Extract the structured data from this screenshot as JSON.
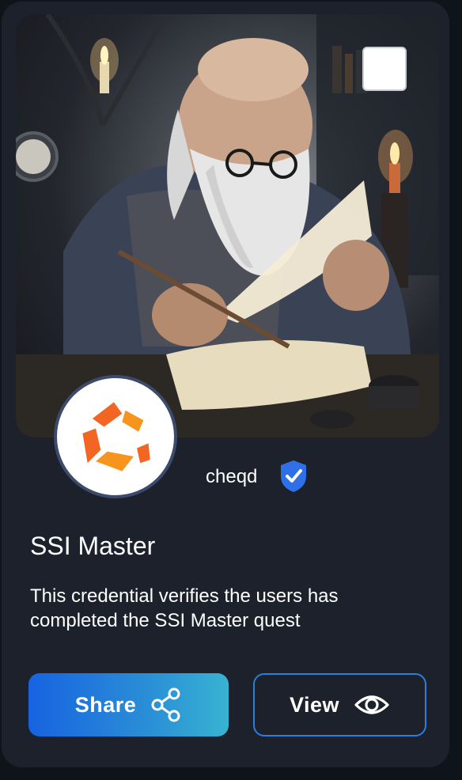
{
  "card": {
    "issuer": {
      "name": "cheqd",
      "logo_icon": "cheqd-logo-icon",
      "verified_icon": "verified-shield-icon"
    },
    "title": "SSI Master",
    "description": "This credential verifies the users has completed the SSI Master quest",
    "hero_image": "wizard-writing-scroll-illustration",
    "select_checkbox_checked": false
  },
  "actions": {
    "share_label": "Share",
    "share_icon": "share-icon",
    "view_label": "View",
    "view_icon": "eye-icon"
  },
  "colors": {
    "card_background": "#1c212c",
    "logo_orange": "#f26522",
    "verified_blue": "#2f6fe8",
    "share_gradient_start": "#1763e0",
    "share_gradient_end": "#38b3d2",
    "view_border": "#2a7fd8"
  }
}
